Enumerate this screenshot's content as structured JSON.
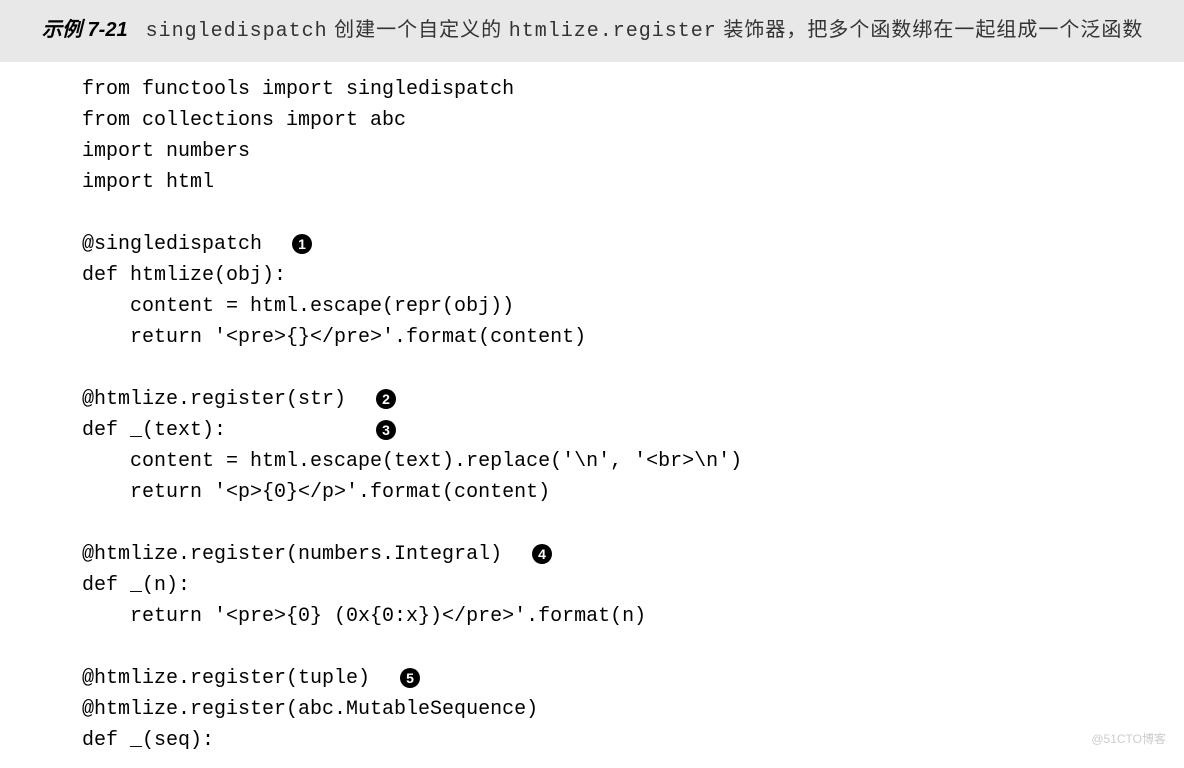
{
  "example": {
    "label": "示例 7-21",
    "title_part1": "singledispatch",
    "title_part2": " 创建一个自定义的 ",
    "title_part3": "htmlize.register",
    "title_part4": " 装饰器，把多个函数绑在一起组成一个泛函数"
  },
  "code": {
    "lines": [
      {
        "text": "from functools import singledispatch"
      },
      {
        "text": "from collections import abc"
      },
      {
        "text": "import numbers"
      },
      {
        "text": "import html"
      },
      {
        "text": ""
      },
      {
        "text": "@singledispatch  ",
        "callout": "1"
      },
      {
        "text": "def htmlize(obj):"
      },
      {
        "text": "    content = html.escape(repr(obj))"
      },
      {
        "text": "    return '<pre>{}</pre>'.format(content)"
      },
      {
        "text": ""
      },
      {
        "text": "@htmlize.register(str)  ",
        "callout": "2"
      },
      {
        "text": "def _(text):            ",
        "callout": "3"
      },
      {
        "text": "    content = html.escape(text).replace('\\n', '<br>\\n')"
      },
      {
        "text": "    return '<p>{0}</p>'.format(content)"
      },
      {
        "text": ""
      },
      {
        "text": "@htmlize.register(numbers.Integral)  ",
        "callout": "4"
      },
      {
        "text": "def _(n):"
      },
      {
        "text": "    return '<pre>{0} (0x{0:x})</pre>'.format(n)"
      },
      {
        "text": ""
      },
      {
        "text": "@htmlize.register(tuple)  ",
        "callout": "5"
      },
      {
        "text": "@htmlize.register(abc.MutableSequence)"
      },
      {
        "text": "def _(seq):"
      }
    ]
  },
  "watermark": "@51CTO博客"
}
